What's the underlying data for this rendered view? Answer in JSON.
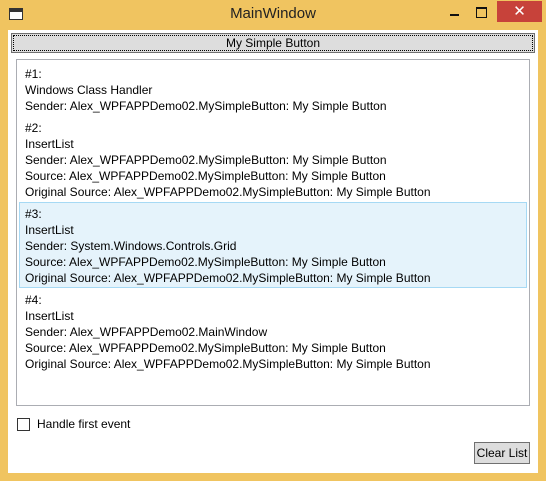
{
  "window": {
    "title": "MainWindow",
    "icon": "app-window-icon",
    "controls": {
      "minimize": "minimize-icon",
      "maximize": "maximize-icon",
      "close": "close-icon",
      "close_glyph": "✕"
    },
    "accent_color": "#f0c460",
    "close_color": "#c7423a"
  },
  "main": {
    "simple_button_label": "My Simple Button",
    "events": [
      {
        "lines": [
          "#1:",
          "Windows Class Handler",
          " Sender: Alex_WPFAPPDemo02.MySimpleButton: My Simple Button"
        ],
        "selected": false
      },
      {
        "lines": [
          "#2:",
          "InsertList",
          " Sender: Alex_WPFAPPDemo02.MySimpleButton: My Simple Button",
          " Source: Alex_WPFAPPDemo02.MySimpleButton: My Simple Button",
          "Original Source: Alex_WPFAPPDemo02.MySimpleButton: My Simple Button"
        ],
        "selected": false
      },
      {
        "lines": [
          "#3:",
          "InsertList",
          " Sender: System.Windows.Controls.Grid",
          " Source: Alex_WPFAPPDemo02.MySimpleButton: My Simple Button",
          "Original Source: Alex_WPFAPPDemo02.MySimpleButton: My Simple Button"
        ],
        "selected": true
      },
      {
        "lines": [
          "#4:",
          "InsertList",
          " Sender: Alex_WPFAPPDemo02.MainWindow",
          " Source: Alex_WPFAPPDemo02.MySimpleButton: My Simple Button",
          "Original Source: Alex_WPFAPPDemo02.MySimpleButton: My Simple Button"
        ],
        "selected": false
      }
    ],
    "handle_first_event_label": "Handle first event",
    "handle_first_event_checked": false,
    "clear_button_label": "Clear List"
  }
}
